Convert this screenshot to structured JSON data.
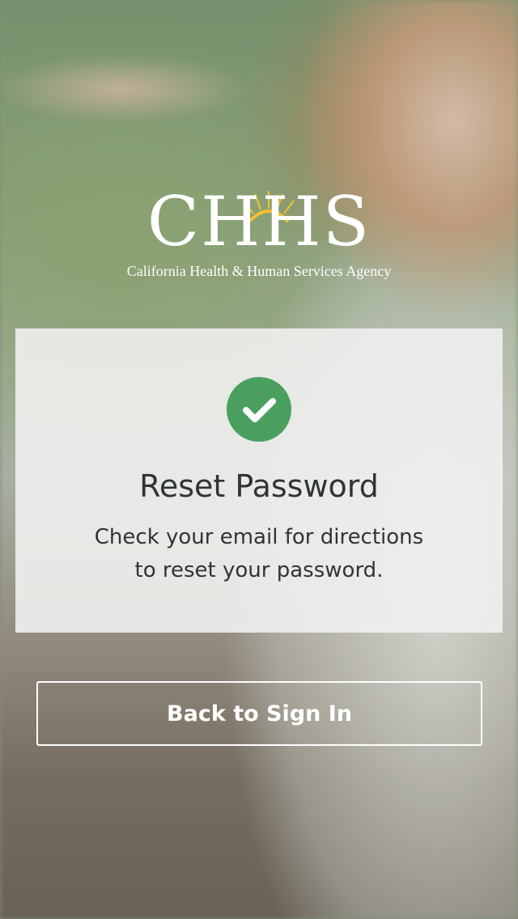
{
  "brand": {
    "logo_text": "CHHS",
    "agency_name": "California Health & Human Services Agency",
    "sun_color": "#f2c230"
  },
  "card": {
    "icon": "check-circle-icon",
    "icon_color": "#4a9f5f",
    "title": "Reset Password",
    "message": "Check your email for directions to reset your password."
  },
  "actions": {
    "back_label": "Back to Sign In"
  }
}
